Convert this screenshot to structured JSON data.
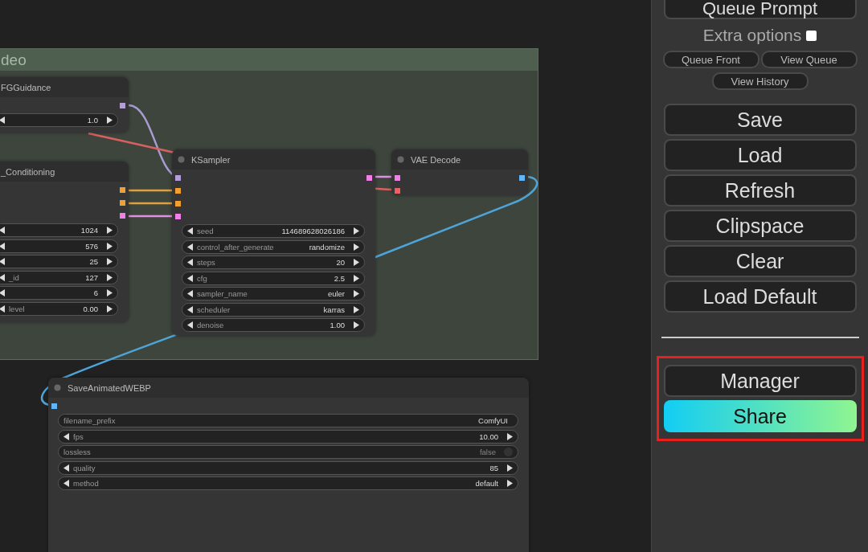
{
  "group": {
    "title": "deo"
  },
  "nodes": [
    {
      "title": "FGGuidance",
      "outputs": [
        {
          "color": "#b39ddb"
        }
      ],
      "widgets": [
        {
          "kind": "number",
          "value": "1.0"
        }
      ]
    },
    {
      "title": "_Conditioning",
      "outputs": [
        {
          "color": "#f0a030"
        },
        {
          "color": "#f0a030"
        },
        {
          "color": "#f080e8"
        }
      ],
      "widgets": [
        {
          "kind": "number",
          "value": "1024"
        },
        {
          "kind": "number",
          "value": "576"
        },
        {
          "kind": "number",
          "value": "25"
        },
        {
          "kind": "number",
          "label": "_id",
          "value": "127"
        },
        {
          "kind": "number",
          "value": "6"
        },
        {
          "kind": "number",
          "label": "level",
          "value": "0.00"
        }
      ]
    },
    {
      "title": "KSampler",
      "inputs": [
        {
          "color": "#b39ddb"
        },
        {
          "color": "#f0a030"
        },
        {
          "color": "#f0a030"
        },
        {
          "color": "#f080e8"
        }
      ],
      "outputs": [
        {
          "color": "#f080e8"
        }
      ],
      "widgets": [
        {
          "kind": "number",
          "label": "seed",
          "value": "114689628026186"
        },
        {
          "kind": "number",
          "label": "control_after_generate",
          "value": "randomize"
        },
        {
          "kind": "number",
          "label": "steps",
          "value": "20"
        },
        {
          "kind": "number",
          "label": "cfg",
          "value": "2.5"
        },
        {
          "kind": "number",
          "label": "sampler_name",
          "value": "euler"
        },
        {
          "kind": "number",
          "label": "scheduler",
          "value": "karras"
        },
        {
          "kind": "number",
          "label": "denoise",
          "value": "1.00"
        }
      ]
    },
    {
      "title": "VAE Decode",
      "inputs": [
        {
          "color": "#f080e8"
        },
        {
          "color": "#f06060"
        }
      ],
      "outputs": [
        {
          "color": "#64b5f6"
        }
      ]
    },
    {
      "title": "SaveAnimatedWEBP",
      "inputs": [
        {
          "color": "#64b5f6"
        }
      ],
      "widgets": [
        {
          "kind": "text",
          "label": "filename_prefix",
          "value": "ComfyUI"
        },
        {
          "kind": "number",
          "label": "fps",
          "value": "10.00"
        },
        {
          "kind": "toggle",
          "label": "lossless",
          "value": "false",
          "on": false
        },
        {
          "kind": "number",
          "label": "quality",
          "value": "85"
        },
        {
          "kind": "number",
          "label": "method",
          "value": "default"
        }
      ]
    }
  ],
  "panel": {
    "queue_button": "Queue Prompt",
    "extra_options": {
      "label": "Extra options",
      "checked": false
    },
    "small_buttons": [
      "Queue Front",
      "View Queue",
      "View History"
    ],
    "buttons": [
      "Save",
      "Load",
      "Refresh",
      "Clipspace",
      "Clear",
      "Load Default"
    ],
    "highlight": {
      "on": true,
      "buttons": [
        {
          "label": "Manager",
          "kind": "plain"
        },
        {
          "label": "Share",
          "kind": "gradient"
        }
      ]
    }
  }
}
